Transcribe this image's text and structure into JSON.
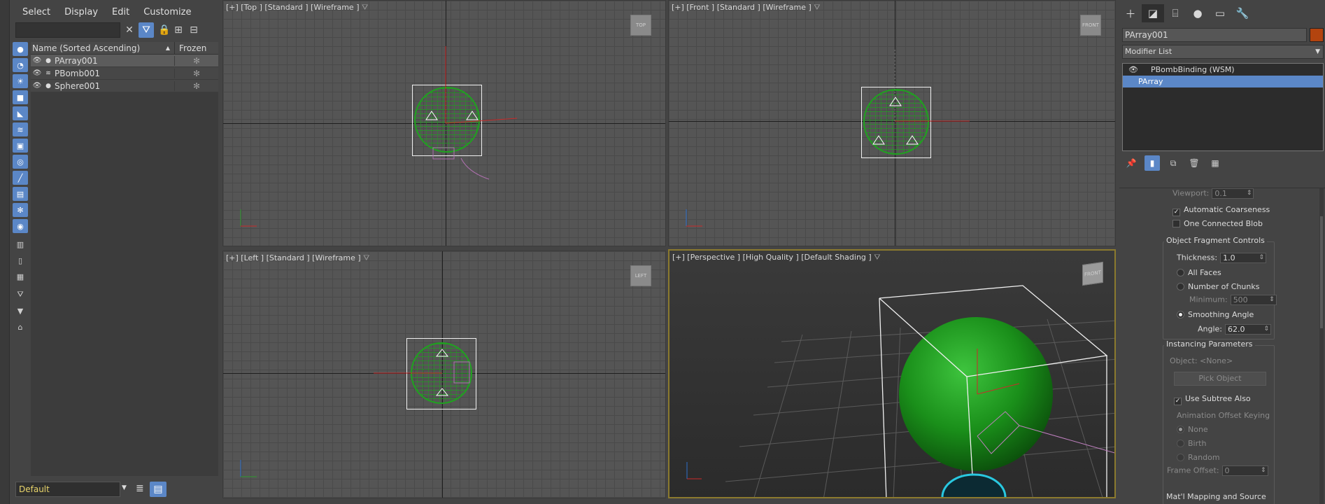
{
  "menu": [
    "Select",
    "Display",
    "Edit",
    "Customize"
  ],
  "explorer": {
    "columns": {
      "name": "Name (Sorted Ascending)",
      "frozen": "Frozen"
    },
    "rows": [
      {
        "name": "PArray001",
        "selected": true
      },
      {
        "name": "PBomb001",
        "selected": false
      },
      {
        "name": "Sphere001",
        "selected": false
      }
    ],
    "layer": "Default"
  },
  "viewports": {
    "top": {
      "label": "[+] [Top ] [Standard ] [Wireframe ]",
      "cube": "TOP"
    },
    "front": {
      "label": "[+] [Front ] [Standard ] [Wireframe ]",
      "cube": "FRONT"
    },
    "left": {
      "label": "[+] [Left ] [Standard ] [Wireframe ]",
      "cube": "LEFT"
    },
    "persp": {
      "label": "[+] [Perspective ] [High Quality ] [Default Shading ]",
      "cube": "FRONT"
    }
  },
  "command_panel": {
    "object_name": "PArray001",
    "object_color": "#b3440f",
    "modifier_list": "Modifier List",
    "stack": [
      "PBombBinding (WSM)",
      "PArray"
    ],
    "rollout": {
      "viewport_label": "Viewport:",
      "viewport_value": "0.1",
      "auto_coarseness": "Automatic Coarseness",
      "one_connected_blob": "One Connected Blob",
      "fragment_title": "Object Fragment Controls",
      "thickness_label": "Thickness:",
      "thickness_value": "1.0",
      "all_faces": "All Faces",
      "number_of_chunks": "Number of Chunks",
      "minimum_label": "Minimum:",
      "minimum_value": "500",
      "smoothing_angle": "Smoothing Angle",
      "angle_label": "Angle:",
      "angle_value": "62.0",
      "instancing_title": "Instancing Parameters",
      "object_label": "Object: <None>",
      "pick_object": "Pick Object",
      "use_subtree": "Use Subtree Also",
      "anim_offset": "Animation Offset Keying",
      "none": "None",
      "birth": "Birth",
      "random": "Random",
      "frame_offset_label": "Frame Offset:",
      "frame_offset_value": "0",
      "matl_title": "Mat'l Mapping and Source"
    }
  },
  "colors": {
    "accent": "#5b87c7",
    "wire_green": "#1fa21f",
    "layer_text": "#e8d46a"
  }
}
